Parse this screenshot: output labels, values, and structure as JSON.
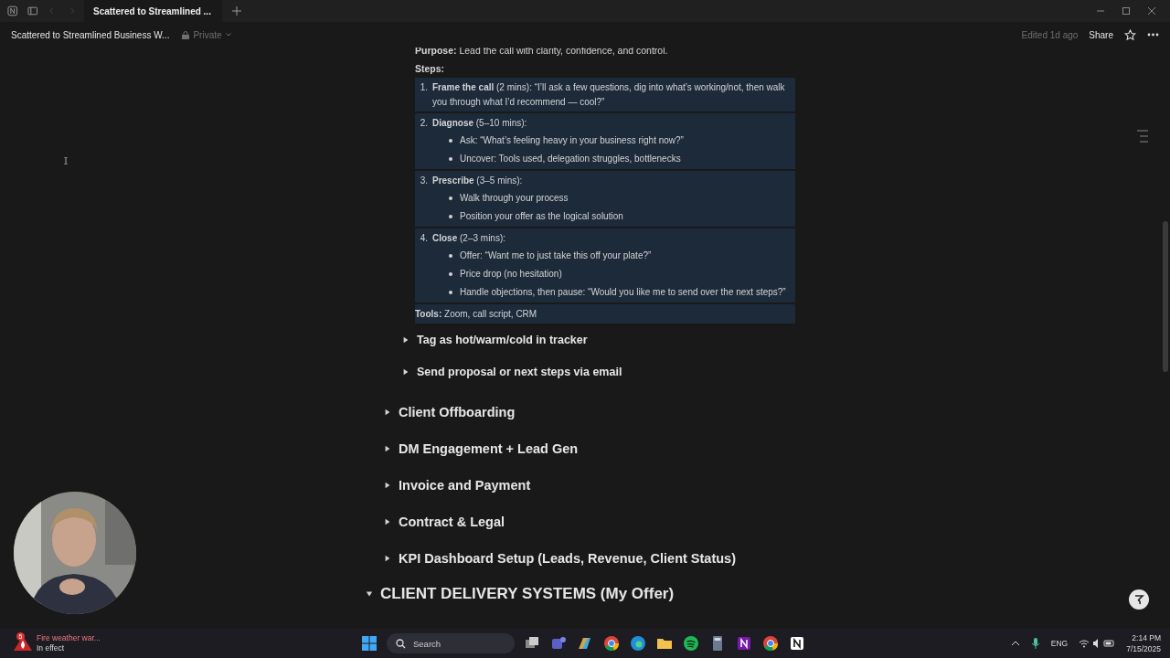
{
  "window": {
    "tab_title": "Scattered to Streamlined ...",
    "page_title": "Scattered to Streamlined Business W...",
    "privacy": "Private",
    "edited": "Edited 1d ago",
    "share": "Share"
  },
  "doc": {
    "purpose": "**Purpose:** Lead the call with clarity, confidence, and control.",
    "steps_label": "Steps:",
    "steps": [
      {
        "number": "1.",
        "text": "**Frame the call** (2 mins): “I’ll ask a few questions, dig into what’s working/not, then walk you through what I’d recommend — cool?”"
      },
      {
        "number": "2.",
        "text": "**Diagnose** (5–10 mins):",
        "bullets": [
          "Ask: “What’s feeling heavy in your business right now?”",
          "Uncover: Tools used, delegation struggles, bottlenecks"
        ]
      },
      {
        "number": "3.",
        "text": "**Prescribe** (3–5 mins):",
        "bullets": [
          "Walk through your process",
          "Position your offer as the logical solution"
        ]
      },
      {
        "number": "4.",
        "text": "**Close** (2–3 mins):",
        "bullets": [
          "Offer: “Want me to just take this off your plate?”",
          "Price drop (no hesitation)",
          "Handle objections, then pause: “Would you like me to send over the next steps?”"
        ]
      }
    ],
    "tools": "**Tools:** Zoom, call script, CRM",
    "subtoggles": [
      {
        "label": "Tag as hot/warm/cold in tracker",
        "expanded": false
      },
      {
        "label": "Send proposal or next steps via email",
        "expanded": false
      }
    ],
    "sections": [
      {
        "label": "Client Offboarding",
        "expanded": false
      },
      {
        "label": "DM Engagement + Lead Gen",
        "expanded": false
      },
      {
        "label": "Invoice and Payment",
        "expanded": false
      },
      {
        "label": "Contract & Legal",
        "expanded": false
      },
      {
        "label": "KPI Dashboard Setup (Leads, Revenue, Client Status)",
        "expanded": false
      }
    ],
    "next_heading": {
      "label": "CLIENT DELIVERY SYSTEMS (My Offer)",
      "expanded": true
    }
  },
  "taskbar": {
    "alert_count": "5",
    "alert_title": "Fire weather war...",
    "alert_subtitle": "In effect",
    "search_placeholder": "Search",
    "language": "ENG",
    "time": "2:14 PM",
    "date": "7/15/2025"
  }
}
